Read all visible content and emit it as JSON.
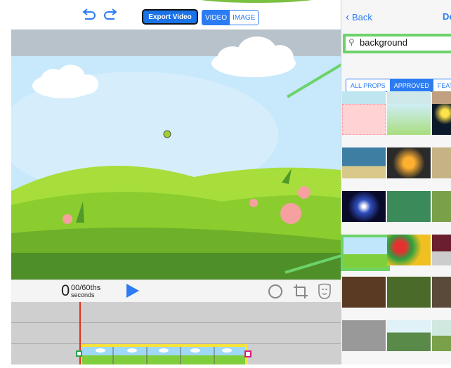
{
  "toolbar": {
    "undo_icon": "undo-icon",
    "redo_icon": "redo-icon",
    "export_label": "Export Video",
    "mode_video": "VIDEO",
    "mode_image": "IMAGE"
  },
  "canvas": {
    "marker_color": "#9ed12b"
  },
  "playbar": {
    "time_value": "0",
    "time_fraction": "00/60ths",
    "time_unit": "seconds",
    "icons": [
      "play-icon",
      "circle-icon",
      "crop-icon",
      "mask-icon"
    ]
  },
  "panel": {
    "back_label": "Back",
    "done_label": "Do",
    "search_value": "background",
    "filters": [
      "ALL PROPS",
      "APPROVED",
      "FEATU"
    ],
    "active_filter": "APPROVED"
  },
  "colors": {
    "accent": "#2b7bf3",
    "highlight": "#6bd36a",
    "playhead": "#e0311d"
  }
}
